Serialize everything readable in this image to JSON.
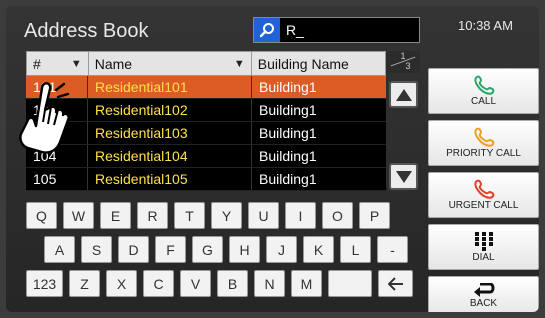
{
  "header": {
    "title": "Address Book",
    "search_value": "R_",
    "clock": "10:38 AM"
  },
  "table": {
    "columns": [
      {
        "label": "#",
        "sortable": true
      },
      {
        "label": "Name",
        "sortable": true
      },
      {
        "label": "Building Name",
        "sortable": false
      }
    ],
    "rows": [
      {
        "num": "101",
        "name": "Residential101",
        "building": "Building1",
        "selected": true
      },
      {
        "num": "102",
        "name": "Residential102",
        "building": "Building1",
        "selected": false
      },
      {
        "num": "103",
        "name": "Residential103",
        "building": "Building1",
        "selected": false
      },
      {
        "num": "104",
        "name": "Residential104",
        "building": "Building1",
        "selected": false
      },
      {
        "num": "105",
        "name": "Residential105",
        "building": "Building1",
        "selected": false
      }
    ],
    "page": {
      "current": "1",
      "total": "3"
    }
  },
  "keyboard": {
    "row1": [
      "Q",
      "W",
      "E",
      "R",
      "T",
      "Y",
      "U",
      "I",
      "O",
      "P"
    ],
    "row2": [
      "A",
      "S",
      "D",
      "F",
      "G",
      "H",
      "J",
      "K",
      "L",
      "-"
    ],
    "row3": [
      "123",
      "Z",
      "X",
      "C",
      "V",
      "B",
      "N",
      "M",
      "",
      ""
    ]
  },
  "actions": {
    "call": "CALL",
    "priority_call": "PRIORITY CALL",
    "urgent_call": "URGENT CALL",
    "dial": "DIAL",
    "back": "BACK"
  },
  "icons": {
    "search": "search-icon",
    "scroll_up": "triangle-up-icon",
    "scroll_down": "triangle-down-icon",
    "call": "phone-icon",
    "dial": "keypad-icon",
    "back": "return-arrow-icon",
    "backspace": "arrow-left-icon",
    "pointer": "hand-pointer-icon"
  },
  "colors": {
    "selected_row": "#dd5b24",
    "name_text": "#ffe14a",
    "call_icon": "#2aa66a",
    "priority_icon": "#f0a020",
    "urgent_icon": "#e0402a",
    "search_button": "#1f63d4"
  }
}
